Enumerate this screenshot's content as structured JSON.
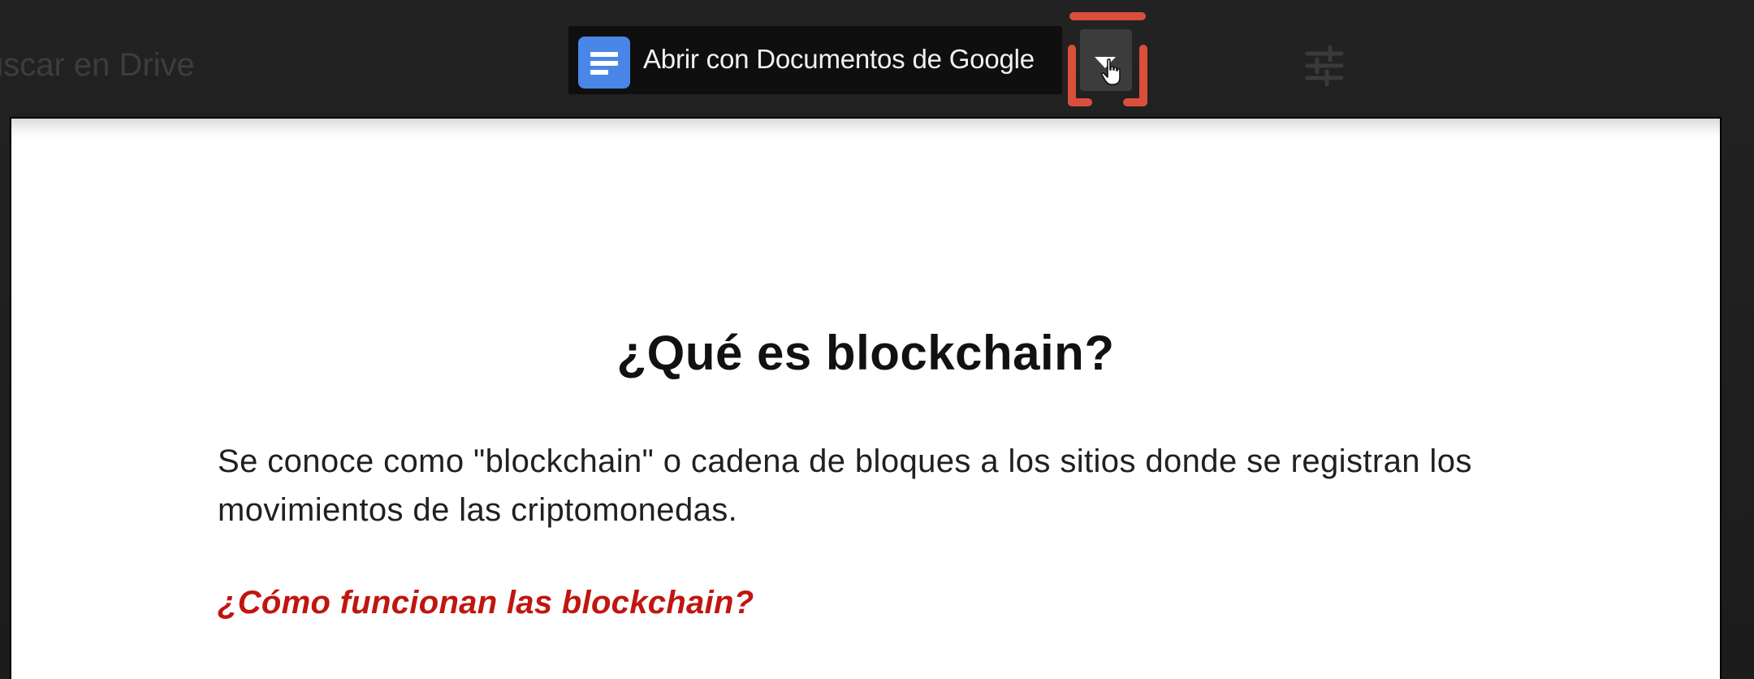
{
  "drive_background": {
    "search_placeholder": "uscar en Drive",
    "filter_icon": "tune-icon"
  },
  "open_with_bar": {
    "app_icon": "google-docs-icon",
    "label": "Abrir con Documentos de Google",
    "dropdown_icon": "arrow-drop-down-icon",
    "cursor_icon": "hand-pointer-icon"
  },
  "annotation": {
    "highlight_color": "#d94f3c",
    "arrow_icon": "arrow-up-icon"
  },
  "document": {
    "title": "¿Qué es blockchain?",
    "paragraph": "Se conoce como \"blockchain\" o cadena de bloques a los sitios donde se registran los movimientos de las criptomonedas.",
    "subheading": "¿Cómo funcionan las blockchain?",
    "subheading_color": "#c0160f"
  }
}
